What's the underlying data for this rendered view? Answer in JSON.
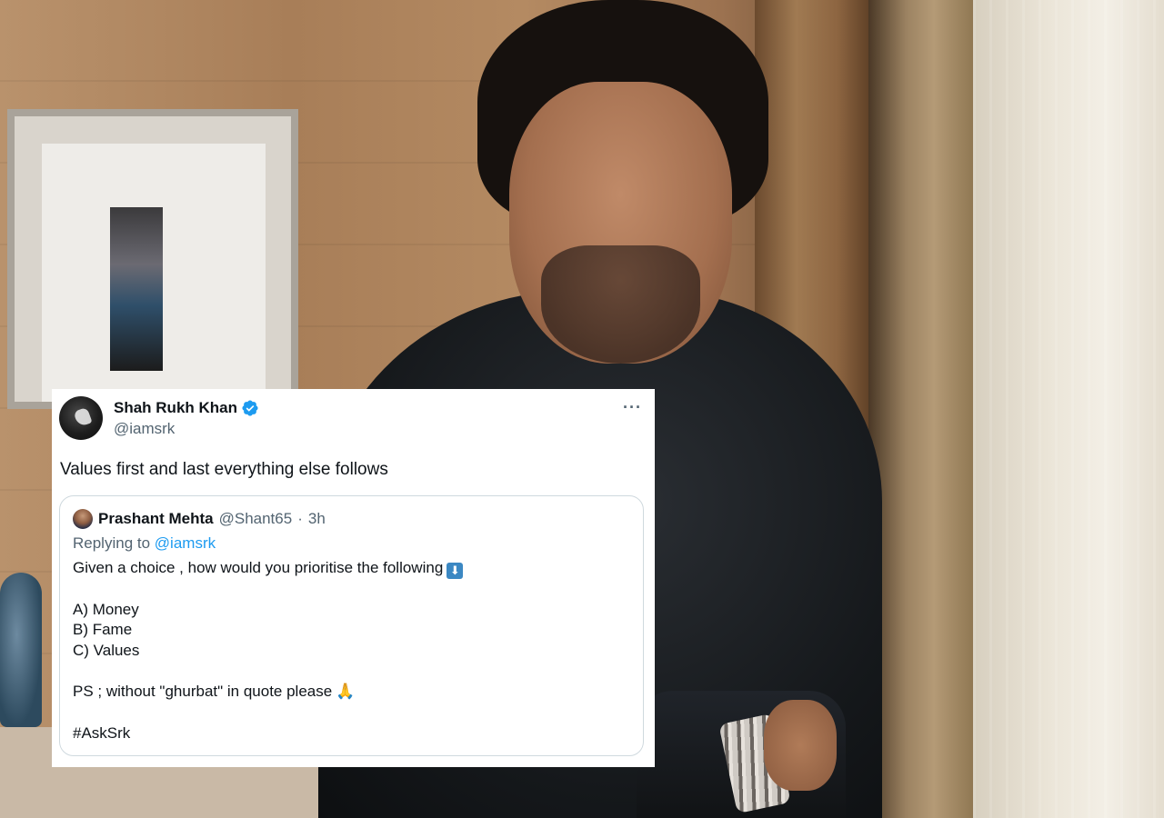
{
  "tweet": {
    "author_name": "Shah Rukh Khan",
    "author_handle": "@iamsrk",
    "text": "Values first and last everything else follows",
    "more_icon": "more-icon",
    "verified_icon": "verified-badge-icon",
    "colors": {
      "verified": "#1d9bf0",
      "secondary_text": "#536471",
      "primary_text": "#0f1419"
    }
  },
  "quoted_tweet": {
    "author_name": "Prashant Mehta",
    "author_handle": "@Shant65",
    "separator": "·",
    "time": "3h",
    "replying_prefix": "Replying to",
    "replying_handle": "@iamsrk",
    "line1": "Given a choice , how would you prioritise the following",
    "down_arrow_emoji": "⬇",
    "option_a": "A) Money",
    "option_b": "B) Fame",
    "option_c": "C) Values",
    "ps_line": "PS ; without \"ghurbat\" in quote please",
    "pray_emoji": "🙏",
    "hashtag": "#AskSrk"
  }
}
